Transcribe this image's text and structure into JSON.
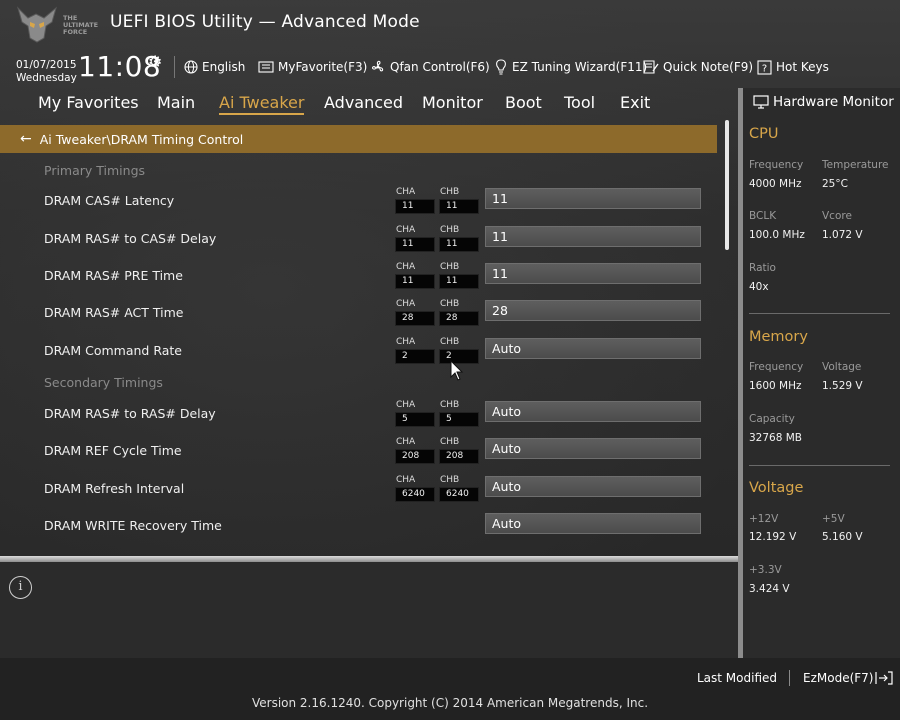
{
  "header": {
    "logo_text": "THE ULTIMATE FORCE",
    "title": "UEFI BIOS Utility — Advanced Mode",
    "date": "01/07/2015",
    "weekday": "Wednesday",
    "time": "11:08",
    "toolbar": {
      "language": "English",
      "myfavorite": "MyFavorite(F3)",
      "qfan": "Qfan Control(F6)",
      "ez_tuning": "EZ Tuning Wizard(F11)",
      "quick_note": "Quick Note(F9)",
      "hot_keys": "Hot Keys"
    }
  },
  "menu": {
    "items": [
      "My Favorites",
      "Main",
      "Ai Tweaker",
      "Advanced",
      "Monitor",
      "Boot",
      "Tool",
      "Exit"
    ],
    "active": "Ai Tweaker"
  },
  "breadcrumb": "Ai Tweaker\\DRAM Timing Control",
  "channels": {
    "a": "CHA",
    "b": "CHB"
  },
  "sections": {
    "primary": "Primary Timings",
    "secondary": "Secondary Timings"
  },
  "settings": [
    {
      "label": "DRAM CAS# Latency",
      "cha": "11",
      "chb": "11",
      "value": "11"
    },
    {
      "label": "DRAM RAS# to CAS# Delay",
      "cha": "11",
      "chb": "11",
      "value": "11"
    },
    {
      "label": "DRAM RAS# PRE Time",
      "cha": "11",
      "chb": "11",
      "value": "11"
    },
    {
      "label": "DRAM RAS# ACT Time",
      "cha": "28",
      "chb": "28",
      "value": "28"
    },
    {
      "label": "DRAM Command Rate",
      "cha": "2",
      "chb": "2",
      "value": "Auto"
    },
    {
      "label": "DRAM RAS# to RAS# Delay",
      "cha": "5",
      "chb": "5",
      "value": "Auto"
    },
    {
      "label": "DRAM REF Cycle Time",
      "cha": "208",
      "chb": "208",
      "value": "Auto"
    },
    {
      "label": "DRAM Refresh Interval",
      "cha": "6240",
      "chb": "6240",
      "value": "Auto"
    },
    {
      "label": "DRAM WRITE Recovery Time",
      "cha": "",
      "chb": "",
      "value": "Auto"
    }
  ],
  "hw_monitor": {
    "title": "Hardware Monitor",
    "cpu": {
      "title": "CPU",
      "frequency_label": "Frequency",
      "frequency": "4000 MHz",
      "temperature_label": "Temperature",
      "temperature": "25°C",
      "bclk_label": "BCLK",
      "bclk": "100.0 MHz",
      "vcore_label": "Vcore",
      "vcore": "1.072 V",
      "ratio_label": "Ratio",
      "ratio": "40x"
    },
    "memory": {
      "title": "Memory",
      "frequency_label": "Frequency",
      "frequency": "1600 MHz",
      "voltage_label": "Voltage",
      "voltage": "1.529 V",
      "capacity_label": "Capacity",
      "capacity": "32768 MB"
    },
    "voltage": {
      "title": "Voltage",
      "v12_label": "+12V",
      "v12": "12.192 V",
      "v5_label": "+5V",
      "v5": "5.160 V",
      "v33_label": "+3.3V",
      "v33": "3.424 V"
    }
  },
  "footer": {
    "last_modified": "Last Modified",
    "ezmode": "EzMode(F7)",
    "version": "Version 2.16.1240. Copyright (C) 2014 American Megatrends, Inc."
  },
  "colors": {
    "accent": "#d8a64a",
    "breadcrumb_bg": "#8d6a2b"
  }
}
